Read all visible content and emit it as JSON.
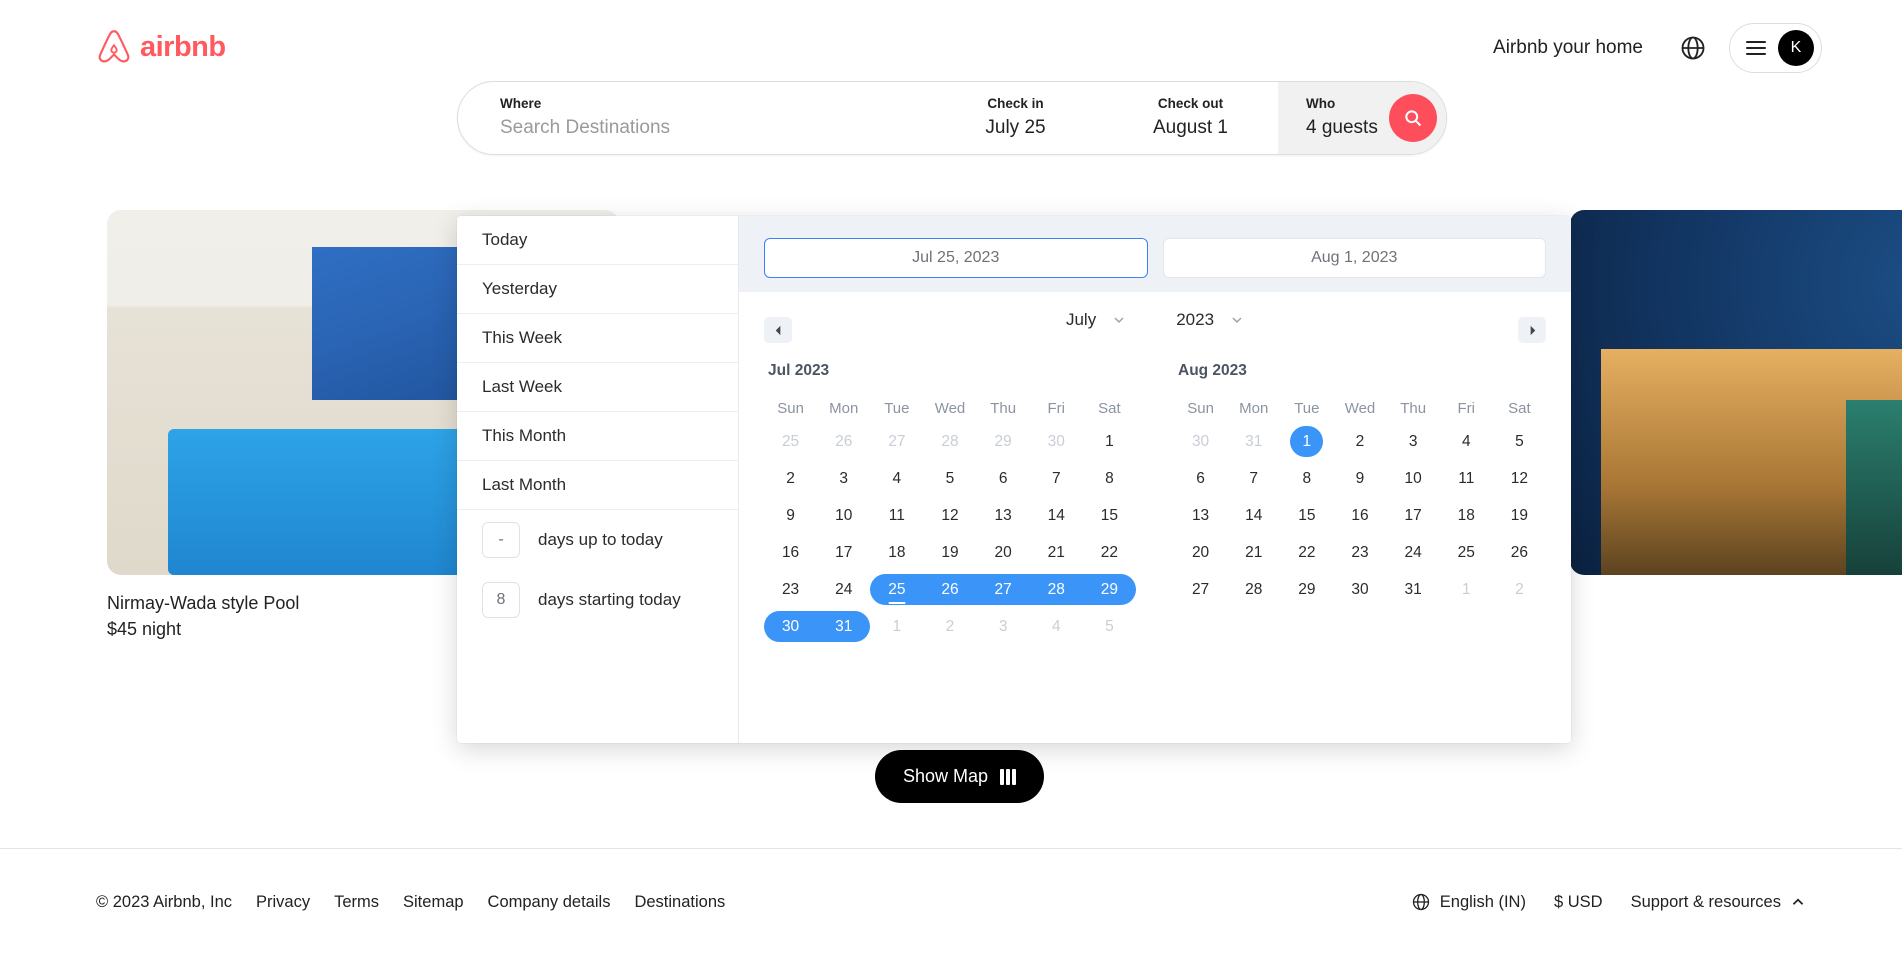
{
  "header": {
    "logo_text": "airbnb",
    "logo_color": "#FF5A5F",
    "host_link": "Airbnb your home",
    "avatar_initial": "K"
  },
  "search": {
    "where_label": "Where",
    "where_placeholder": "Search Destinations",
    "where_value": "",
    "checkin_label": "Check in",
    "checkin_value": "July 25",
    "checkout_label": "Check out",
    "checkout_value": "August 1",
    "who_label": "Who",
    "who_value": "4 guests",
    "search_button_color": "#FF4E5B"
  },
  "listings": [
    {
      "title": "Nirmay-Wada style Pool",
      "price": "$45 night",
      "favorited": false
    },
    {
      "title": "",
      "price": "",
      "favorited": true
    }
  ],
  "show_map": {
    "label": "Show Map"
  },
  "datepicker": {
    "presets": [
      "Today",
      "Yesterday",
      "This Week",
      "Last Week",
      "This Month",
      "Last Month"
    ],
    "relative": [
      {
        "value": "-",
        "label": "days up to today"
      },
      {
        "value": "8",
        "label": "days starting today"
      }
    ],
    "range_inputs": [
      {
        "value": "Jul 25, 2023",
        "focused": true
      },
      {
        "value": "Aug 1, 2023",
        "focused": false
      }
    ],
    "month_select": "July",
    "year_select": "2023",
    "accent_color": "#3B94F7",
    "dow": [
      "Sun",
      "Mon",
      "Tue",
      "Wed",
      "Thu",
      "Fri",
      "Sat"
    ],
    "months": [
      {
        "title": "Jul 2023",
        "weeks": [
          [
            {
              "d": "25",
              "s": "muted"
            },
            {
              "d": "26",
              "s": "muted"
            },
            {
              "d": "27",
              "s": "muted"
            },
            {
              "d": "28",
              "s": "muted"
            },
            {
              "d": "29",
              "s": "muted"
            },
            {
              "d": "30",
              "s": "muted"
            },
            {
              "d": "1",
              "s": "normal"
            }
          ],
          [
            {
              "d": "2",
              "s": "normal"
            },
            {
              "d": "3",
              "s": "normal"
            },
            {
              "d": "4",
              "s": "normal"
            },
            {
              "d": "5",
              "s": "normal"
            },
            {
              "d": "6",
              "s": "normal"
            },
            {
              "d": "7",
              "s": "normal"
            },
            {
              "d": "8",
              "s": "normal"
            }
          ],
          [
            {
              "d": "9",
              "s": "normal"
            },
            {
              "d": "10",
              "s": "normal"
            },
            {
              "d": "11",
              "s": "normal"
            },
            {
              "d": "12",
              "s": "normal"
            },
            {
              "d": "13",
              "s": "normal"
            },
            {
              "d": "14",
              "s": "normal"
            },
            {
              "d": "15",
              "s": "normal"
            }
          ],
          [
            {
              "d": "16",
              "s": "normal"
            },
            {
              "d": "17",
              "s": "normal"
            },
            {
              "d": "18",
              "s": "normal"
            },
            {
              "d": "19",
              "s": "normal"
            },
            {
              "d": "20",
              "s": "normal"
            },
            {
              "d": "21",
              "s": "normal"
            },
            {
              "d": "22",
              "s": "normal"
            }
          ],
          [
            {
              "d": "23",
              "s": "normal"
            },
            {
              "d": "24",
              "s": "normal"
            },
            {
              "d": "25",
              "s": "start"
            },
            {
              "d": "26",
              "s": "range"
            },
            {
              "d": "27",
              "s": "range"
            },
            {
              "d": "28",
              "s": "range"
            },
            {
              "d": "29",
              "s": "range"
            }
          ],
          [
            {
              "d": "30",
              "s": "range"
            },
            {
              "d": "31",
              "s": "range"
            },
            {
              "d": "1",
              "s": "muted"
            },
            {
              "d": "2",
              "s": "muted"
            },
            {
              "d": "3",
              "s": "muted"
            },
            {
              "d": "4",
              "s": "muted"
            },
            {
              "d": "5",
              "s": "muted"
            }
          ]
        ],
        "pills": [
          {
            "row": 4,
            "from": 2,
            "to": 6
          },
          {
            "row": 5,
            "from": 0,
            "to": 1
          }
        ]
      },
      {
        "title": "Aug 2023",
        "weeks": [
          [
            {
              "d": "30",
              "s": "muted"
            },
            {
              "d": "31",
              "s": "muted"
            },
            {
              "d": "1",
              "s": "sel"
            },
            {
              "d": "2",
              "s": "normal"
            },
            {
              "d": "3",
              "s": "normal"
            },
            {
              "d": "4",
              "s": "normal"
            },
            {
              "d": "5",
              "s": "normal"
            }
          ],
          [
            {
              "d": "6",
              "s": "normal"
            },
            {
              "d": "7",
              "s": "normal"
            },
            {
              "d": "8",
              "s": "normal"
            },
            {
              "d": "9",
              "s": "normal"
            },
            {
              "d": "10",
              "s": "normal"
            },
            {
              "d": "11",
              "s": "normal"
            },
            {
              "d": "12",
              "s": "normal"
            }
          ],
          [
            {
              "d": "13",
              "s": "normal"
            },
            {
              "d": "14",
              "s": "normal"
            },
            {
              "d": "15",
              "s": "normal"
            },
            {
              "d": "16",
              "s": "normal"
            },
            {
              "d": "17",
              "s": "normal"
            },
            {
              "d": "18",
              "s": "normal"
            },
            {
              "d": "19",
              "s": "normal"
            }
          ],
          [
            {
              "d": "20",
              "s": "normal"
            },
            {
              "d": "21",
              "s": "normal"
            },
            {
              "d": "22",
              "s": "normal"
            },
            {
              "d": "23",
              "s": "normal"
            },
            {
              "d": "24",
              "s": "normal"
            },
            {
              "d": "25",
              "s": "normal"
            },
            {
              "d": "26",
              "s": "normal"
            }
          ],
          [
            {
              "d": "27",
              "s": "normal"
            },
            {
              "d": "28",
              "s": "normal"
            },
            {
              "d": "29",
              "s": "normal"
            },
            {
              "d": "30",
              "s": "normal"
            },
            {
              "d": "31",
              "s": "normal"
            },
            {
              "d": "1",
              "s": "muted"
            },
            {
              "d": "2",
              "s": "muted"
            }
          ]
        ],
        "pills": [
          {
            "row": 0,
            "from": 2,
            "to": 2
          }
        ]
      }
    ]
  },
  "footer": {
    "copyright": "© 2023 Airbnb, Inc",
    "links": [
      "Privacy",
      "Terms",
      "Sitemap",
      "Company details",
      "Destinations"
    ],
    "language": "English (IN)",
    "currency": "$ USD",
    "support": "Support & resources"
  }
}
